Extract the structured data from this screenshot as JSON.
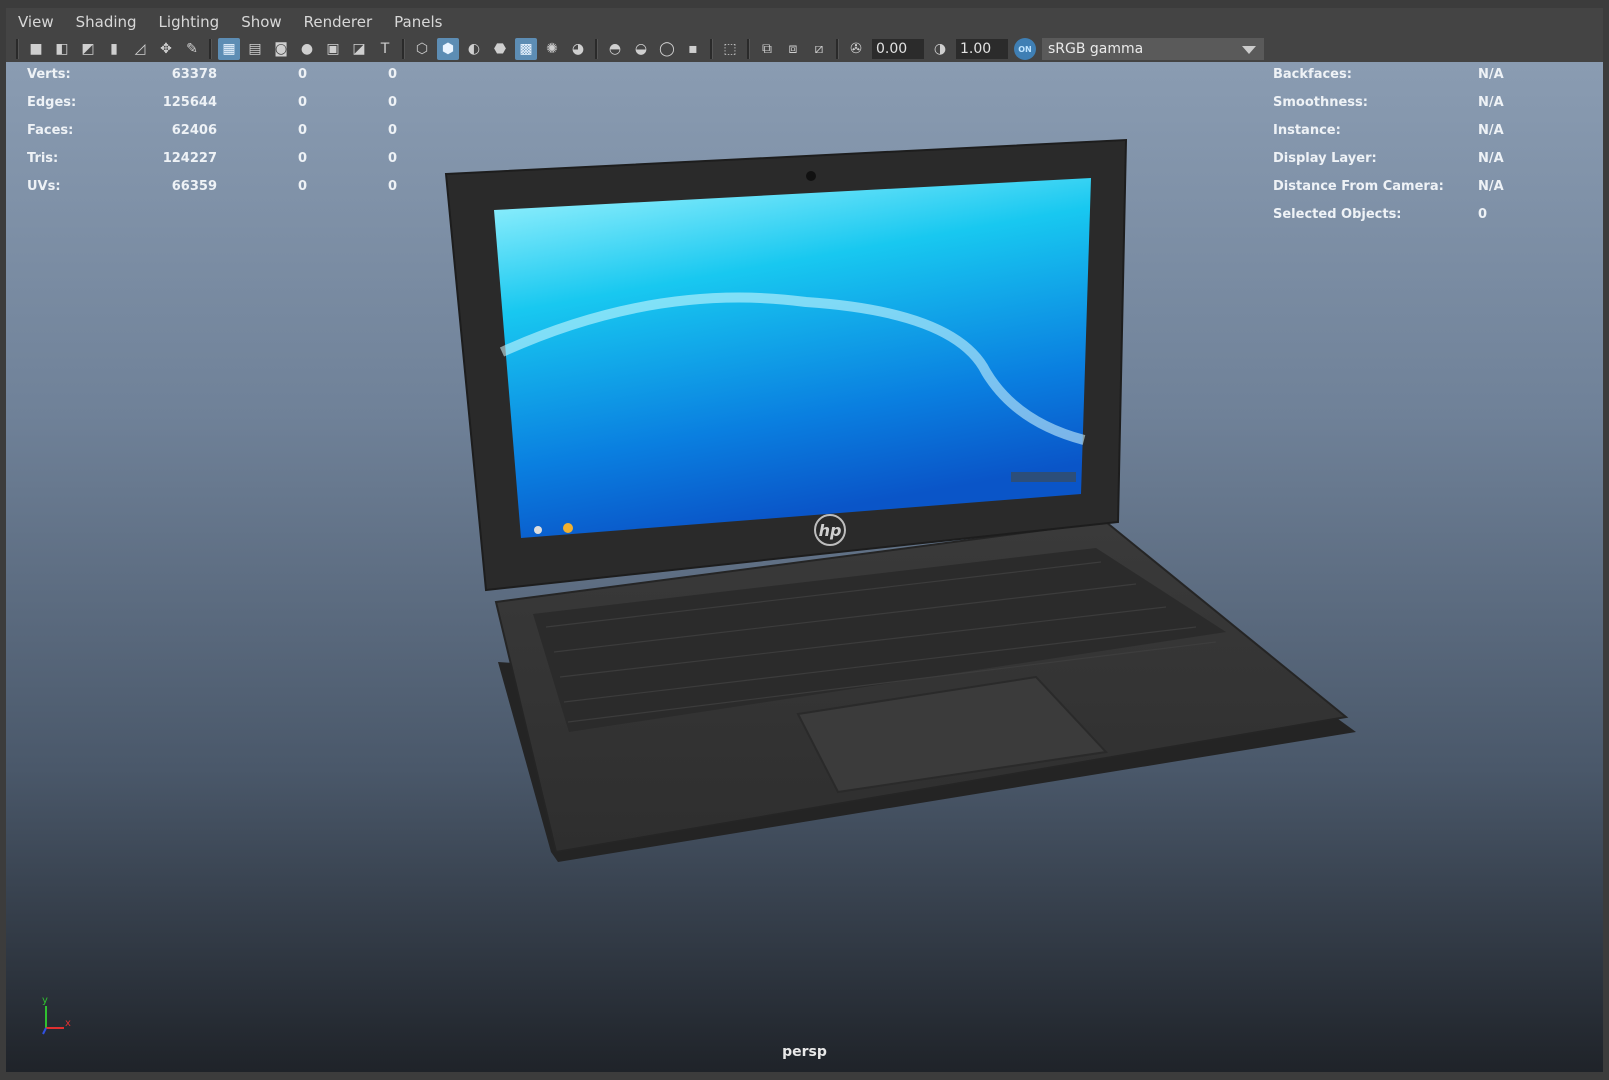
{
  "menu": [
    "View",
    "Shading",
    "Lighting",
    "Show",
    "Renderer",
    "Panels"
  ],
  "toolbar": {
    "exposure_value": "0.00",
    "gamma_value": "1.00",
    "color_mgmt_badge": "ON",
    "color_space": "sRGB gamma",
    "icons": [
      "select-camera-icon",
      "camera-attributes-icon",
      "bookmarks-icon",
      "bookmark-icon",
      "image-plane-icon",
      "2d-pan-zoom-icon",
      "grease-pencil-icon",
      "grid-icon",
      "film-gate-icon",
      "resolution-gate-icon",
      "gate-mask-icon",
      "field-chart-icon",
      "safe-action-icon",
      "safe-title-icon",
      "wireframe-icon",
      "smooth-shade-icon",
      "default-material-icon",
      "wireframe-on-shaded-icon",
      "xray-icon",
      "use-all-lights-icon",
      "shadows-icon",
      "screen-space-ao-icon",
      "motion-blur-icon",
      "multisample-aa-icon",
      "depth-of-field-icon",
      "isolate-select-icon",
      "xray-joints-icon",
      "xray-active-components-icon",
      "backface-culling-icon",
      "exposure-icon",
      "gamma-icon"
    ]
  },
  "hud_left": {
    "rows": [
      {
        "label": "Verts:",
        "v1": "63378",
        "v2": "0",
        "v3": "0"
      },
      {
        "label": "Edges:",
        "v1": "125644",
        "v2": "0",
        "v3": "0"
      },
      {
        "label": "Faces:",
        "v1": "62406",
        "v2": "0",
        "v3": "0"
      },
      {
        "label": "Tris:",
        "v1": "124227",
        "v2": "0",
        "v3": "0"
      },
      {
        "label": "UVs:",
        "v1": "66359",
        "v2": "0",
        "v3": "0"
      }
    ]
  },
  "hud_right": {
    "rows": [
      {
        "label": "Backfaces:",
        "value": "N/A"
      },
      {
        "label": "Smoothness:",
        "value": "N/A"
      },
      {
        "label": "Instance:",
        "value": "N/A"
      },
      {
        "label": "Display Layer:",
        "value": "N/A"
      },
      {
        "label": "Distance From Camera:",
        "value": "N/A"
      },
      {
        "label": "Selected Objects:",
        "value": "0"
      }
    ]
  },
  "viewport": {
    "camera_label": "persp",
    "logo_text": "hp",
    "axis_y": "y",
    "axis_x": "x"
  },
  "colors": {
    "accent": "#5d8db4",
    "axis_x": "#e03030",
    "axis_y": "#30c030",
    "axis_z": "#3050e0"
  }
}
